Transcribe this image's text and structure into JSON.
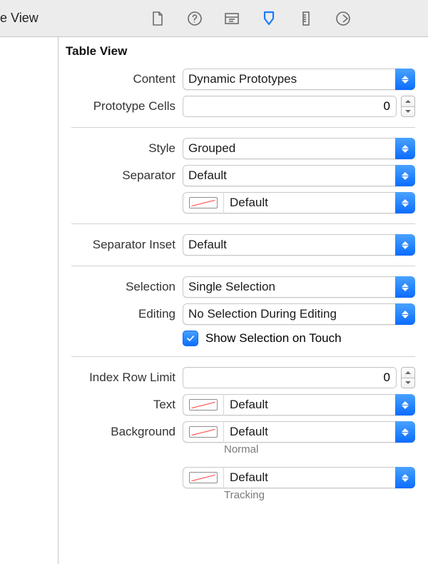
{
  "toolbar": {
    "left_fragment": "e View",
    "icons": [
      "file",
      "help",
      "identity",
      "attributes",
      "size",
      "connections"
    ],
    "active_index": 3
  },
  "section_title": "Table View",
  "rows": {
    "content": {
      "label": "Content",
      "value": "Dynamic Prototypes"
    },
    "prototype_cells": {
      "label": "Prototype Cells",
      "value": "0"
    },
    "style": {
      "label": "Style",
      "value": "Grouped"
    },
    "separator": {
      "label": "Separator",
      "value": "Default"
    },
    "separator_color": {
      "value": "Default"
    },
    "separator_inset": {
      "label": "Separator Inset",
      "value": "Default"
    },
    "selection": {
      "label": "Selection",
      "value": "Single Selection"
    },
    "editing": {
      "label": "Editing",
      "value": "No Selection During Editing"
    },
    "show_touch": {
      "checked": true,
      "label": "Show Selection on Touch"
    },
    "index_row_limit": {
      "label": "Index Row Limit",
      "value": "0"
    },
    "text": {
      "label": "Text",
      "value": "Default"
    },
    "background": {
      "label": "Background",
      "value": "Default"
    },
    "normal_caption": "Normal",
    "tracking": {
      "value": "Default"
    },
    "tracking_caption": "Tracking"
  }
}
